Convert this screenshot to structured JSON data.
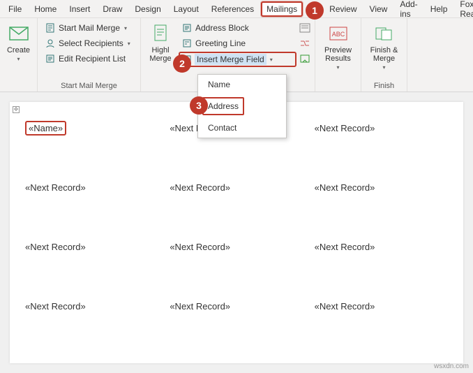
{
  "menu": {
    "items": [
      "File",
      "Home",
      "Insert",
      "Draw",
      "Design",
      "Layout",
      "References",
      "Mailings",
      "Review",
      "View",
      "Add-ins",
      "Help",
      "Foxit Rea"
    ],
    "activeIndex": 7
  },
  "ribbon": {
    "create": {
      "label": "Create"
    },
    "startGroup": {
      "label": "Start Mail Merge",
      "startMailMerge": "Start Mail Merge",
      "selectRecipients": "Select Recipients",
      "editRecipientList": "Edit Recipient List"
    },
    "writeGroup": {
      "highlight": "Highl\nMerge",
      "addressBlock": "Address Block",
      "greetingLine": "Greeting Line",
      "insertMergeField": "Insert Merge Field"
    },
    "previewGroup": {
      "label": "Preview Results",
      "btn": "Preview\nResults"
    },
    "finishGroup": {
      "label": "Finish",
      "btn": "Finish &\nMerge"
    }
  },
  "dropdown": {
    "items": [
      "Name",
      "Address",
      "Contact"
    ],
    "highlightIndex": 1
  },
  "callouts": {
    "c1": "1",
    "c2": "2",
    "c3": "3"
  },
  "document": {
    "first": "«Name»",
    "next": "«Next Record»"
  },
  "watermark": "wsxdn.com"
}
